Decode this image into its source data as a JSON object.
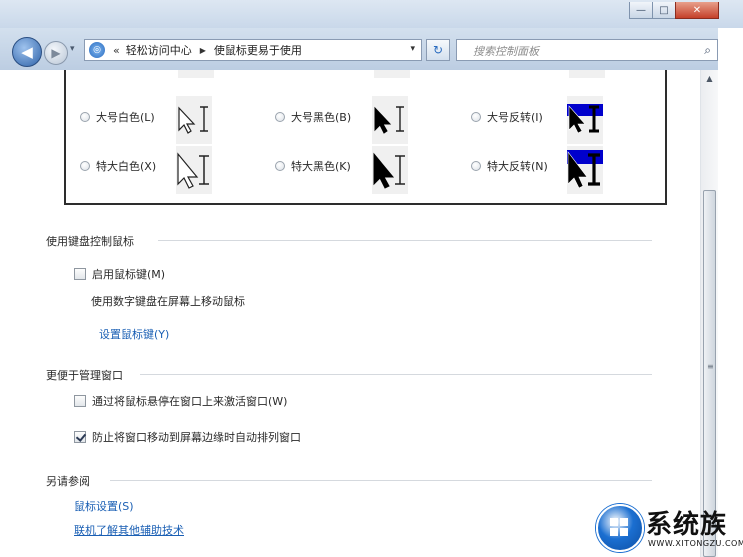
{
  "window": {
    "minimize_glyph": "—",
    "maximize_glyph": "□",
    "close_glyph": "✕"
  },
  "nav": {
    "back_glyph": "◀",
    "forward_glyph": "▶",
    "history_glyph": "▾",
    "breadcrumb_sep": "«",
    "crumbs": [
      "轻松访问中心",
      "使鼠标更易于使用"
    ],
    "crumb_arrow": "▶",
    "address_dropdown_glyph": "▾",
    "refresh_glyph": "↻",
    "search_placeholder": "搜索控制面板",
    "search_icon_glyph": "⌕"
  },
  "pointer_schemes": {
    "rows": [
      [
        {
          "label": "大号白色(L)",
          "style": "white"
        },
        {
          "label": "大号黑色(B)",
          "style": "black"
        },
        {
          "label": "大号反转(I)",
          "style": "inverted"
        }
      ],
      [
        {
          "label": "特大白色(X)",
          "style": "white"
        },
        {
          "label": "特大黑色(K)",
          "style": "black"
        },
        {
          "label": "特大反转(N)",
          "style": "inverted"
        }
      ]
    ]
  },
  "keyboard_section": {
    "title": "使用键盘控制鼠标",
    "mouse_keys_label": "启用鼠标键(M)",
    "mouse_keys_checked": false,
    "description": "使用数字键盘在屏幕上移动鼠标",
    "setup_link": "设置鼠标键(Y)"
  },
  "window_section": {
    "title": "更便于管理窗口",
    "hover_activate_label": "通过将鼠标悬停在窗口上来激活窗口(W)",
    "hover_activate_checked": false,
    "prevent_arrange_label": "防止将窗口移动到屏幕边缘时自动排列窗口",
    "prevent_arrange_checked": true
  },
  "see_also": {
    "title": "另请参阅",
    "links": [
      "鼠标设置(S)",
      "联机了解其他辅助技术"
    ]
  },
  "scrollbar": {
    "up_glyph": "▲",
    "grip_glyph": "≡"
  },
  "watermark": {
    "name": "系统族",
    "url": "WWW.XITONGZU.COM"
  },
  "colors": {
    "link": "#1a5fb4",
    "inverted_bg": "#0000cc",
    "titlebar": "#c9d8ea"
  }
}
